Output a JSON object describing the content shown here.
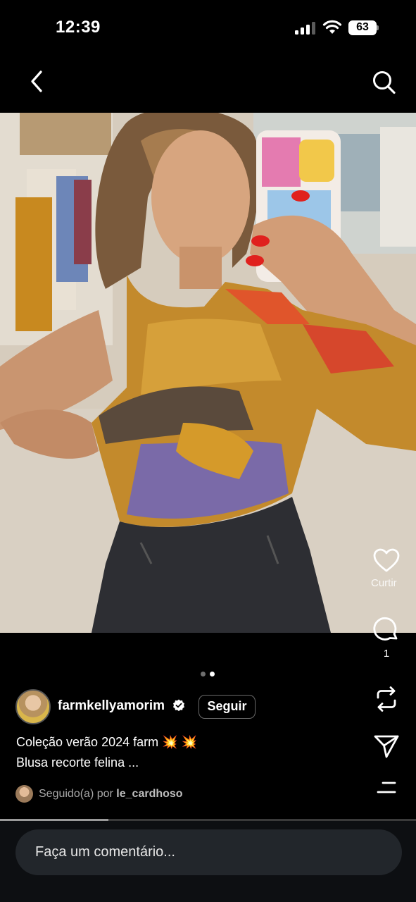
{
  "status_bar": {
    "time": "12:39",
    "battery_level": "63",
    "signal_icon": "cellular-signal-icon",
    "wifi_icon": "wifi-icon"
  },
  "nav": {
    "back_icon": "chevron-left-icon",
    "search_icon": "search-icon"
  },
  "media": {
    "description_icon": "photo",
    "carousel": {
      "total": 2,
      "active_index": 1
    },
    "colors": {
      "dot_active": "#ffffff",
      "dot_inactive": "#6e6e6e"
    }
  },
  "actions": {
    "like_label": "Curtir",
    "comment_count": "1",
    "like_icon": "heart-icon",
    "comment_icon": "comment-bubble-icon",
    "repost_icon": "repost-icon",
    "share_icon": "send-icon",
    "more_icon": "menu-lines-icon"
  },
  "post": {
    "username": "farmkellyamorim",
    "verified": true,
    "follow_label": "Seguir",
    "caption_line1": "Coleção verão 2024 farm 💥 💥",
    "caption_line2": "Blusa recorte felina ...",
    "followed_prefix": "Seguido(a) por",
    "followed_by": "le_cardhoso"
  },
  "progress": {
    "fraction": 0.26
  },
  "comment": {
    "placeholder": "Faça um comentário..."
  }
}
